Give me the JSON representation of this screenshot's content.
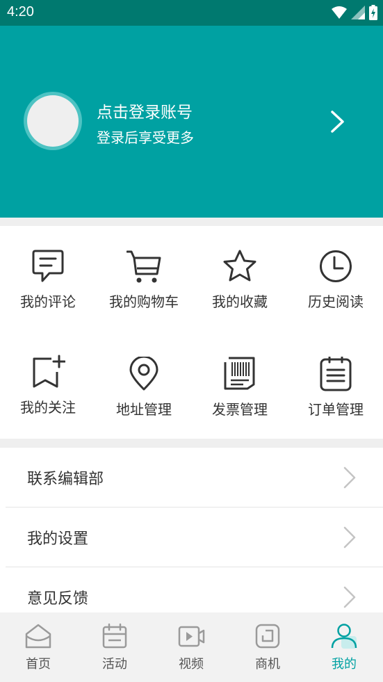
{
  "status_bar": {
    "time": "4:20"
  },
  "profile": {
    "title": "点击登录账号",
    "subtitle": "登录后享受更多"
  },
  "grid": {
    "items": [
      {
        "label": "我的评论"
      },
      {
        "label": "我的购物车"
      },
      {
        "label": "我的收藏"
      },
      {
        "label": "历史阅读"
      },
      {
        "label": "我的关注"
      },
      {
        "label": "地址管理"
      },
      {
        "label": "发票管理"
      },
      {
        "label": "订单管理"
      }
    ]
  },
  "list": {
    "items": [
      {
        "label": "联系编辑部"
      },
      {
        "label": "我的设置"
      },
      {
        "label": "意见反馈"
      }
    ]
  },
  "tabbar": {
    "tabs": [
      {
        "label": "首页"
      },
      {
        "label": "活动"
      },
      {
        "label": "视频"
      },
      {
        "label": "商机"
      },
      {
        "label": "我的"
      }
    ],
    "active_index": 4
  },
  "colors": {
    "primary": "#00a1a2",
    "status_bar": "#00796f",
    "icon_gray": "#9a9a9a"
  }
}
